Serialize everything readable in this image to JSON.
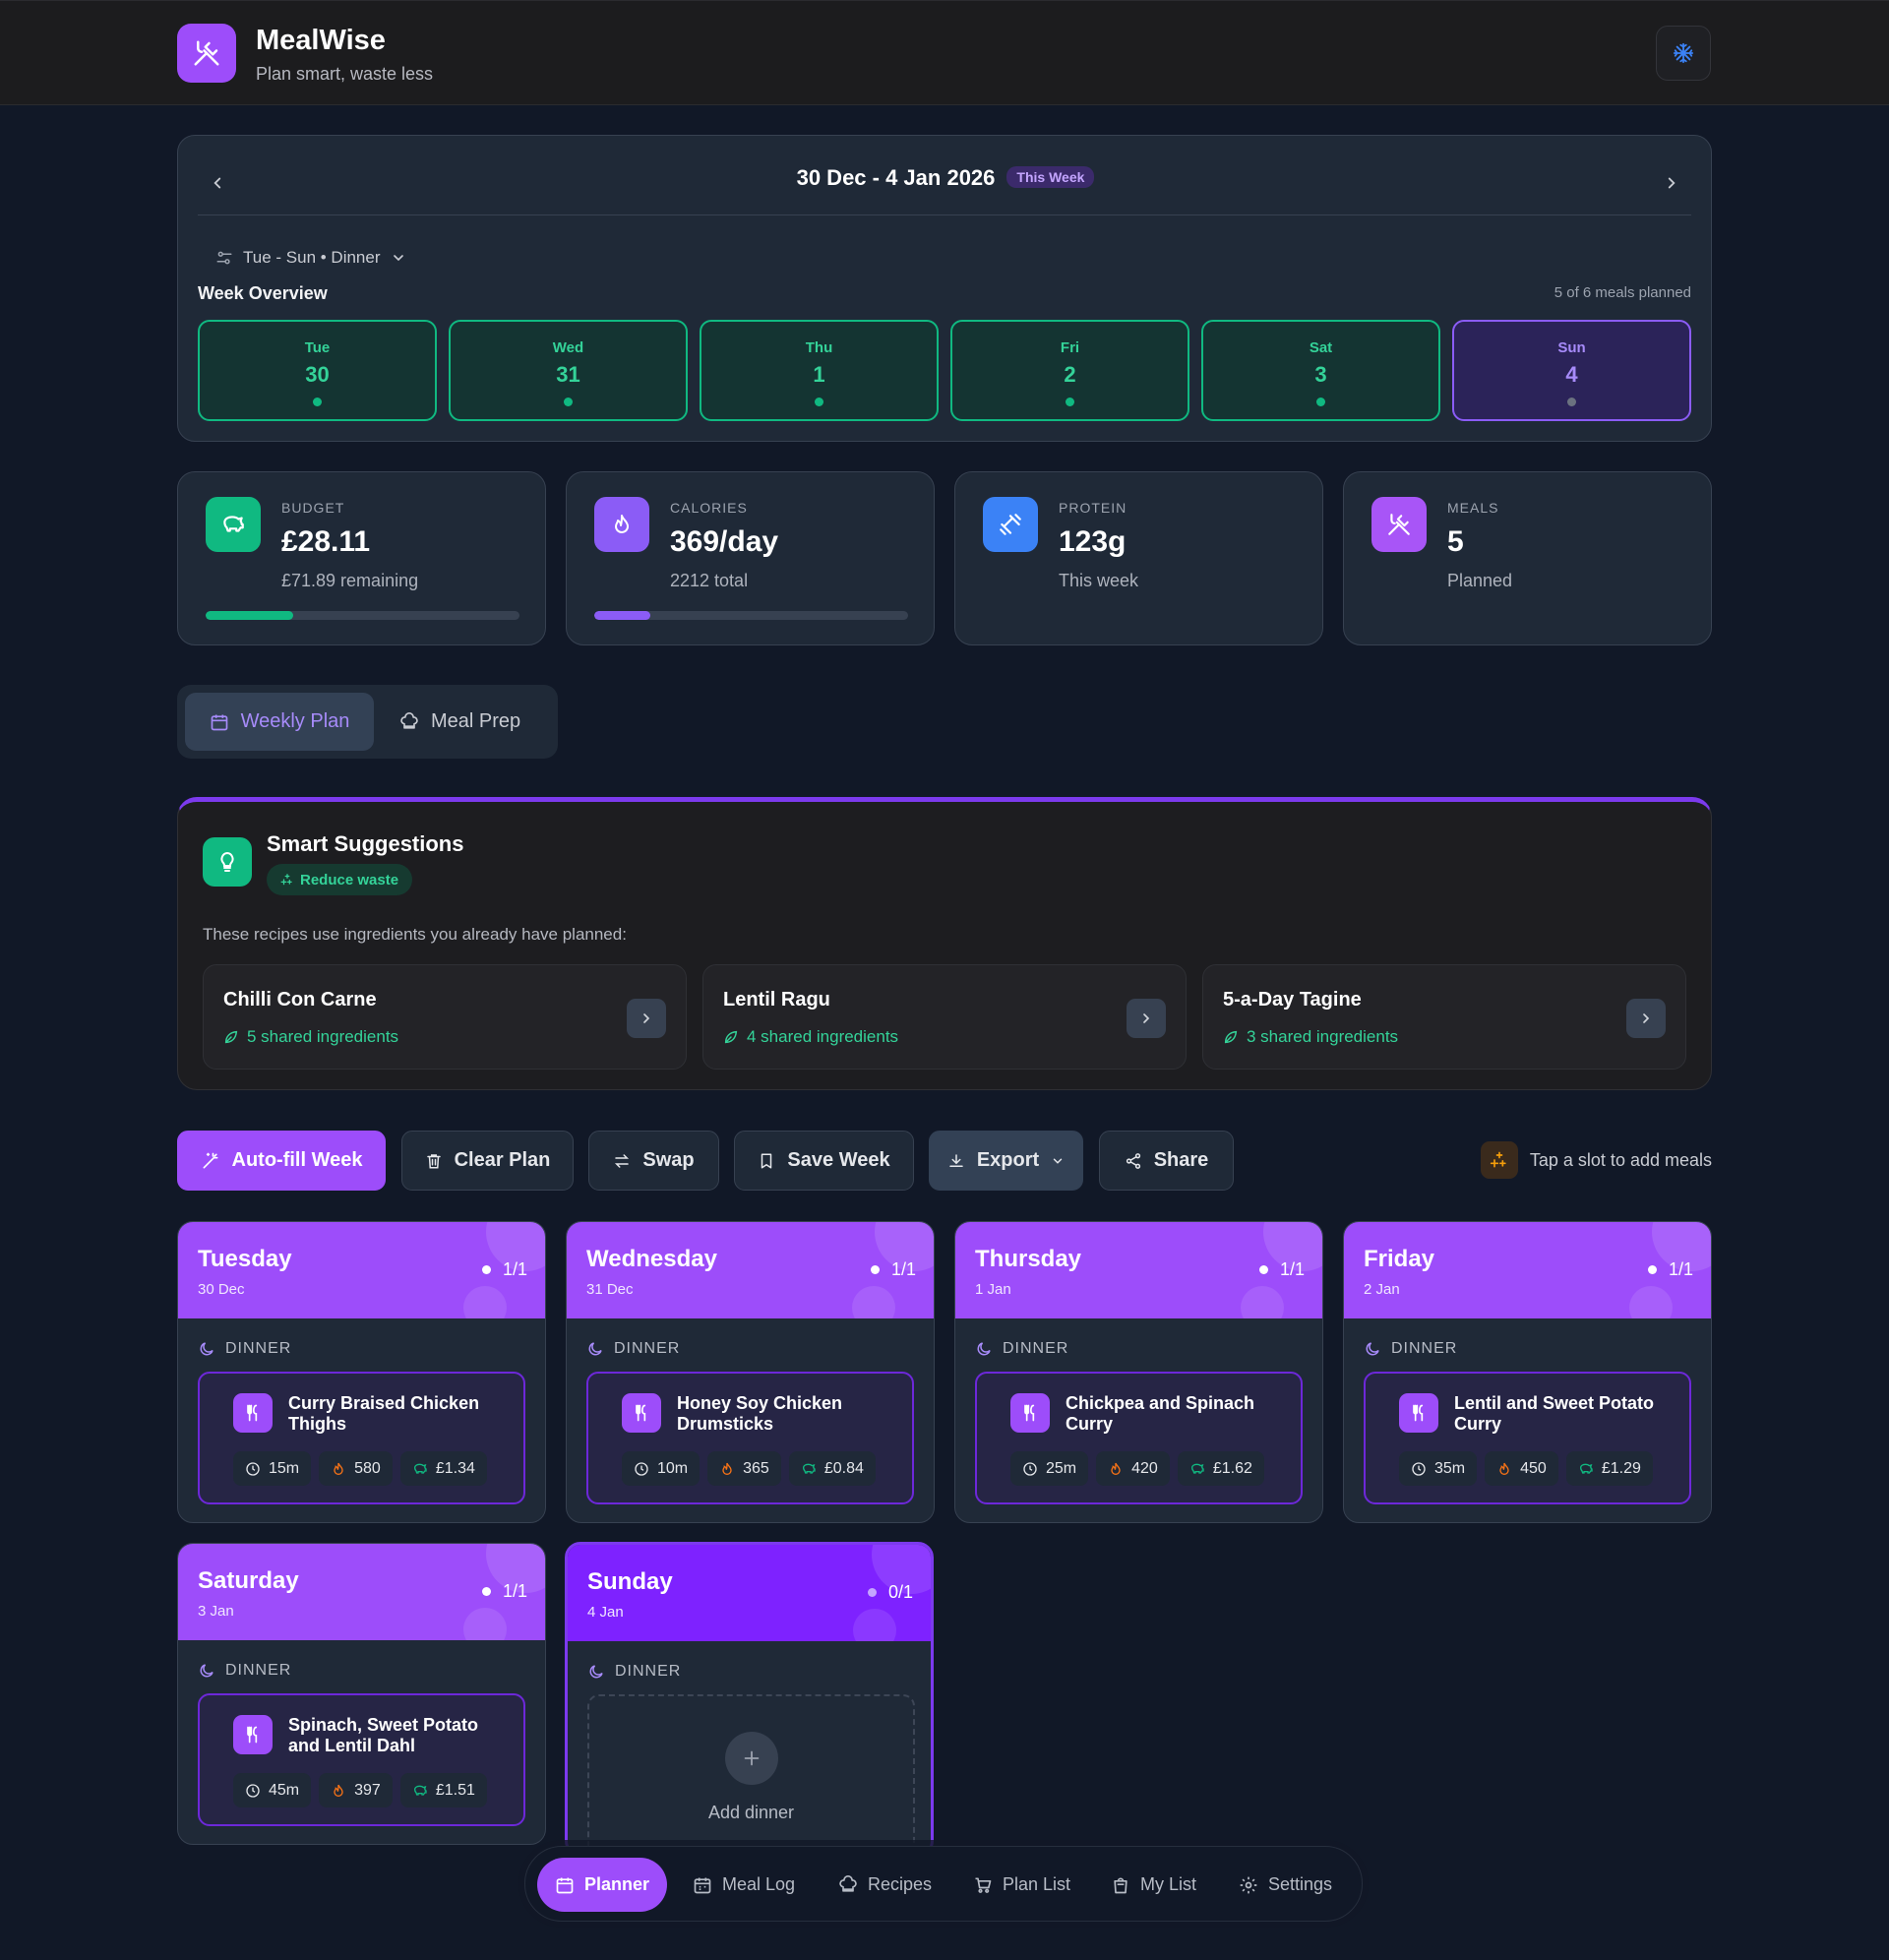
{
  "app": {
    "title": "MealWise",
    "subtitle": "Plan smart, waste less"
  },
  "week": {
    "range": "30 Dec - 4 Jan 2026",
    "badge": "This Week",
    "filter": "Tue - Sun • Dinner",
    "overview_label": "Week Overview",
    "planned_count": "5 of 6 meals planned",
    "days": [
      {
        "name": "Tue",
        "date": "30"
      },
      {
        "name": "Wed",
        "date": "31"
      },
      {
        "name": "Thu",
        "date": "1"
      },
      {
        "name": "Fri",
        "date": "2"
      },
      {
        "name": "Sat",
        "date": "3"
      },
      {
        "name": "Sun",
        "date": "4"
      }
    ]
  },
  "stats": {
    "budget": {
      "label": "BUDGET",
      "value": "£28.11",
      "sub": "£71.89 remaining",
      "progress": 0.28,
      "color": "#10b981"
    },
    "calories": {
      "label": "CALORIES",
      "value": "369/day",
      "sub": "2212 total",
      "progress": 0.18,
      "color": "#8b5cf6"
    },
    "protein": {
      "label": "PROTEIN",
      "value": "123g",
      "sub": "This week",
      "color": "#3b82f6"
    },
    "meals": {
      "label": "MEALS",
      "value": "5",
      "sub": "Planned",
      "color": "#a855f7"
    }
  },
  "tabs": {
    "weekly": "Weekly Plan",
    "prep": "Meal Prep"
  },
  "suggestions": {
    "title": "Smart Suggestions",
    "badge": "Reduce waste",
    "description": "These recipes use ingredients you already have planned:",
    "items": [
      {
        "name": "Chilli Con Carne",
        "shared": "5 shared ingredients"
      },
      {
        "name": "Lentil Ragu",
        "shared": "4 shared ingredients"
      },
      {
        "name": "5-a-Day Tagine",
        "shared": "3 shared ingredients"
      }
    ]
  },
  "actions": {
    "autofill": "Auto-fill Week",
    "clear": "Clear Plan",
    "swap": "Swap",
    "save": "Save Week",
    "export": "Export",
    "share": "Share",
    "tip": "Tap a slot to add meals"
  },
  "slot_label": "DINNER",
  "days": [
    {
      "name": "Tuesday",
      "date": "30 Dec",
      "progress": "1/1",
      "meal": "Curry Braised Chicken Thighs",
      "time": "15m",
      "kcal": "580",
      "cost": "£1.34"
    },
    {
      "name": "Wednesday",
      "date": "31 Dec",
      "progress": "1/1",
      "meal": "Honey Soy Chicken Drumsticks",
      "time": "10m",
      "kcal": "365",
      "cost": "£0.84"
    },
    {
      "name": "Thursday",
      "date": "1 Jan",
      "progress": "1/1",
      "meal": "Chickpea and Spinach Curry",
      "time": "25m",
      "kcal": "420",
      "cost": "£1.62"
    },
    {
      "name": "Friday",
      "date": "2 Jan",
      "progress": "1/1",
      "meal": "Lentil and Sweet Potato Curry",
      "time": "35m",
      "kcal": "450",
      "cost": "£1.29"
    },
    {
      "name": "Saturday",
      "date": "3 Jan",
      "progress": "1/1",
      "meal": "Spinach, Sweet Potato and Lentil Dahl",
      "time": "45m",
      "kcal": "397",
      "cost": "£1.51"
    },
    {
      "name": "Sunday",
      "date": "4 Jan",
      "progress": "0/1",
      "add_label": "Add dinner"
    }
  ],
  "bottom_nav": {
    "planner": "Planner",
    "meal_log": "Meal Log",
    "recipes": "Recipes",
    "plan_list": "Plan List",
    "my_list": "My List",
    "settings": "Settings"
  }
}
